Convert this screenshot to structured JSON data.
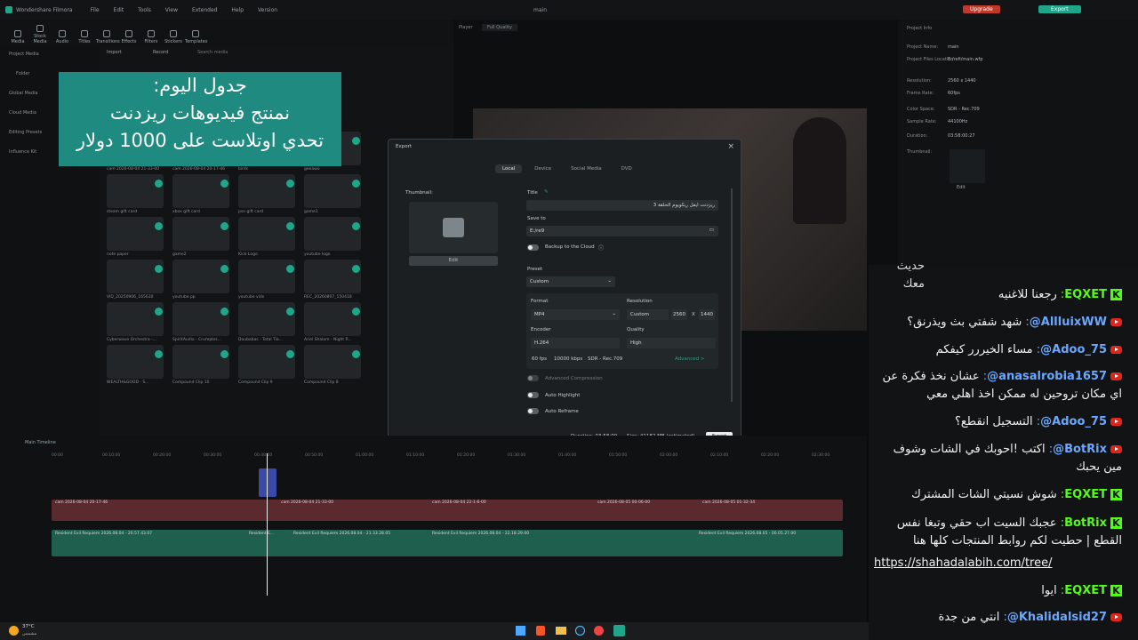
{
  "app": {
    "name": "Wondershare Filmora",
    "menu": [
      "File",
      "Edit",
      "Tools",
      "View",
      "Extended",
      "Help",
      "Version"
    ],
    "project_title": "main",
    "upgrade_label": "Upgrade",
    "export_label": "Export"
  },
  "toolbar": [
    "Media",
    "Stock Media",
    "Audio",
    "Titles",
    "Transitions",
    "Effects",
    "Filters",
    "Stickers",
    "Templates"
  ],
  "leftnav": [
    "Project Media",
    "Folder",
    "Global Media",
    "Cloud Media",
    "Editing Presets",
    "Influence Kit"
  ],
  "media_bar": {
    "import": "Import",
    "record": "Record",
    "search_placeholder": "Search media"
  },
  "media_items": [
    {
      "label": "cam 2026-08-04 21-33-00"
    },
    {
      "label": "cam 2026-08-04 20-17-46"
    },
    {
      "label": "birds"
    },
    {
      "label": "geeawo"
    },
    {
      "label": "steam gift card"
    },
    {
      "label": "xbox gift card"
    },
    {
      "label": "psn gift card"
    },
    {
      "label": "game1"
    },
    {
      "label": "note paper"
    },
    {
      "label": "game2"
    },
    {
      "label": "Kick-Logo"
    },
    {
      "label": "youtube logo"
    },
    {
      "label": "VID_20250906_165630"
    },
    {
      "label": "youtube pp"
    },
    {
      "label": "youtube vids"
    },
    {
      "label": "REC_20260807_150418"
    },
    {
      "label": "Cyberwave Orchestra -..."
    },
    {
      "label": "SpiritAudio - Crumples..."
    },
    {
      "label": "Doubabas - Total Tia..."
    },
    {
      "label": "Ariel Shalom - Night R..."
    },
    {
      "label": "WEALTH&GOOD - S..."
    },
    {
      "label": "Compound Clip 10"
    },
    {
      "label": "Compound Clip 9"
    },
    {
      "label": "Compound Clip 8"
    }
  ],
  "player": {
    "label": "Player",
    "quality": "Full Quality"
  },
  "project_info": {
    "header": "Project Info",
    "rows": [
      {
        "k": "Project Name:",
        "v": "main"
      },
      {
        "k": "Project Files Location:",
        "v": "E:/refi/main.wfp"
      },
      {
        "k": "Resolution:",
        "v": "2560 x 1440"
      },
      {
        "k": "Frame Rate:",
        "v": "60fps"
      },
      {
        "k": "Color Space:",
        "v": "SDR - Rec.709"
      },
      {
        "k": "Sample Rate:",
        "v": "44100Hz"
      },
      {
        "k": "Duration:",
        "v": "03:58:00:27"
      },
      {
        "k": "Thumbnail:",
        "v": ""
      }
    ],
    "edit": "Edit"
  },
  "overlay_text": [
    "جدول اليوم:",
    "نمنتج فيديوهات ريزدنت",
    "تحدي اوتلاست على 1000 دولار"
  ],
  "export_dialog": {
    "title": "Export",
    "tabs": [
      "Local",
      "Device",
      "Social Media",
      "DVD"
    ],
    "thumbnail_label": "Thumbnail:",
    "edit": "Edit",
    "title_label": "Title",
    "title_value": "ريزدنت ايفل ريكويوم الحلقة 3",
    "save_to_label": "Save to",
    "save_to_value": "E:/re9",
    "backup_label": "Backup to the Cloud",
    "preset_label": "Preset",
    "preset_value": "Custom",
    "format_label": "Format",
    "format_value": "MP4",
    "resolution_label": "Resolution",
    "resolution_value": "Custom",
    "res_w": "2560",
    "res_x": "X",
    "res_h": "1440",
    "encoder_label": "Encoder",
    "encoder_value": "H.264",
    "quality_label": "Quality",
    "quality_value": "High",
    "fps": "60 fps",
    "bitrate": "10000 kbps",
    "color": "SDR - Rec.709",
    "advanced": "Advanced >",
    "adv_compression": "Advanced Compression",
    "auto_highlight": "Auto Highlight",
    "auto_reframe": "Auto Reframe",
    "duration": "Duration: 03:58:00",
    "size": "Size: 41182 MB (estimated)",
    "export_btn": "Export"
  },
  "timeline": {
    "label": "Main Timeline",
    "times": [
      "00:00",
      "00:10:00",
      "00:20:00",
      "00:30:00",
      "00:40:00",
      "00:50:00",
      "01:00:00",
      "01:10:00",
      "01:20:00",
      "01:30:00",
      "01:40:00",
      "01:50:00",
      "02:00:00",
      "02:10:00",
      "02:20:00",
      "02:30:00"
    ],
    "clips_video": [
      "cam 2026-08-04 20-17-46",
      "cam 2026-08-04 21-33-00",
      "cam 2026-08-04 22-1-6-00",
      "cam 2026-08-05 00-06-00",
      "cam 2026-08-05 01-32-34"
    ],
    "clips_game": [
      "Resident Evil Requiem 2026.08.04 - 20.57.43.07",
      "Resident E...",
      "Resident Evil Requiem 2026.08.04 - 21.33.28.05",
      "Resident Evil Requiem 2026.08.04 - 22.18.29.00",
      "Resident Evil Requiem 2026.08.05 - 00.05.27.00"
    ]
  },
  "chat": [
    {
      "platform": "kick",
      "name": "EQXET",
      "text": "رجعنا للاغنيه"
    },
    {
      "platform": "youtube",
      "name": "@AllluixWW",
      "text": "شهد شفتي بث ويذرنق؟"
    },
    {
      "platform": "youtube",
      "name": "@Adoo_75",
      "text": "مساء الخيررر كيفكم"
    },
    {
      "platform": "youtube",
      "name": "@anasalrobia1657",
      "text": "عشان نخذ فكرة عن اي مكان تروحين له ممكن اخذ اهلي معي"
    },
    {
      "platform": "youtube",
      "name": "@Adoo_75",
      "text": "التسجيل انقطع؟"
    },
    {
      "platform": "youtube",
      "name": "@BotRix",
      "text": "اكتب !احوبك في الشات وشوف مين يحبك"
    },
    {
      "platform": "kick",
      "name": "EQXET",
      "text": "شوش نسيتي الشات المشترك"
    },
    {
      "platform": "kick",
      "name": "BotRix",
      "text": "عجبك السيت اب حقي وتبغا نفس القطع | حطيت لكم روابط المنتجات كلها هنا"
    },
    {
      "platform": "kick",
      "name": "",
      "text": "https://shahadalabih.com/tree/"
    },
    {
      "platform": "kick",
      "name": "EQXET",
      "text": "ايوا"
    },
    {
      "platform": "youtube",
      "name": "@Khalidalsid27",
      "text": "انتي من جدة"
    }
  ],
  "chat_top_partial": "حديث معك",
  "taskbar": {
    "temp": "37°C",
    "weather": "مشمس"
  },
  "colors": {
    "accent": "#1fa58a",
    "kick": "#53fc18",
    "youtube": "#e0261b",
    "overlay": "#1e8a80",
    "yt_name": "#6aa7ff"
  }
}
